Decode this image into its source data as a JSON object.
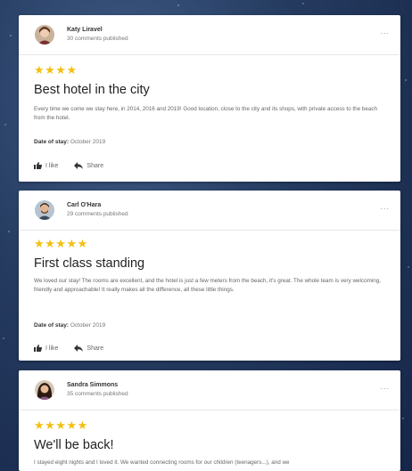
{
  "reviews": [
    {
      "author": "Katy Liravel",
      "comments": "30 comments published",
      "stars": "★★★★",
      "title": "Best hotel in the city",
      "body": "Every time we come we stay here, in 2014, 2016 and 2019! Good location, close to the city and its shops, with private access to the beach from the hotel.",
      "date_label": "Date of stay:",
      "date_value": "October 2019",
      "like": "I like",
      "share": "Share",
      "more": "..."
    },
    {
      "author": "Carl O'Hara",
      "comments": "29 comments published",
      "stars": "★★★★★",
      "title": "First class standing",
      "body": "We loved our stay! The rooms are excellent, and the hotel is just a few meters from the beach, it's great. The whole team is very welcoming, friendly and approachable! It really makes all the difference, all these little things.",
      "date_label": "Date of stay:",
      "date_value": "October 2019",
      "like": "I like",
      "share": "Share",
      "more": "..."
    },
    {
      "author": "Sandra Simmons",
      "comments": "35 comments published",
      "stars": "★★★★★",
      "title": "We'll be back!",
      "body": "I stayed eight nights and I loved it. We wanted connecting rooms for our children (teenagers...), and we",
      "more": "..."
    }
  ],
  "colors": {
    "star": "#f2c013",
    "background": "#1f3359"
  }
}
